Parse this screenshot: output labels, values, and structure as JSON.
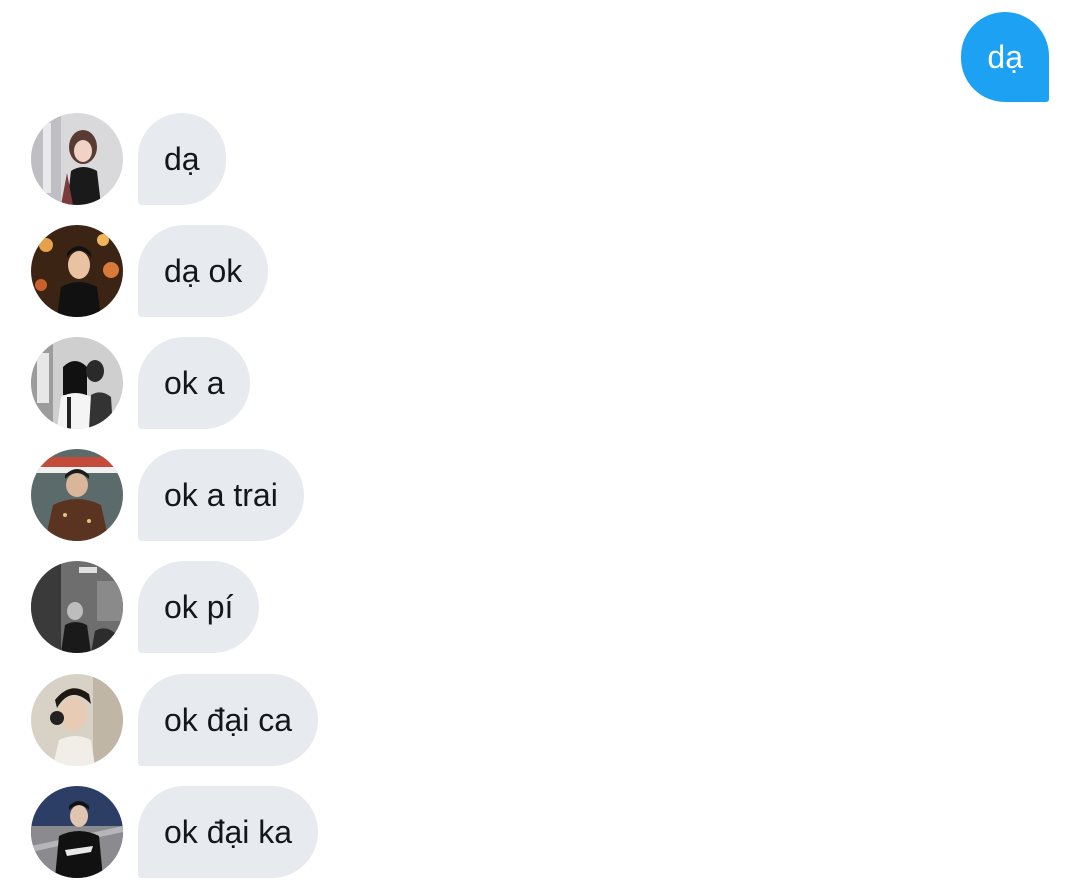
{
  "colors": {
    "outgoing_bubble": "#1da1f2",
    "incoming_bubble": "#e7ebef",
    "incoming_text": "#14171a",
    "outgoing_text": "#ffffff"
  },
  "outgoing": [
    {
      "text": "dạ"
    }
  ],
  "incoming": [
    {
      "avatar": "avatar-photo-1",
      "text": "dạ"
    },
    {
      "avatar": "avatar-photo-2",
      "text": "dạ ok"
    },
    {
      "avatar": "avatar-photo-3",
      "text": "ok a"
    },
    {
      "avatar": "avatar-photo-4",
      "text": "ok a trai"
    },
    {
      "avatar": "avatar-photo-5",
      "text": "ok pí"
    },
    {
      "avatar": "avatar-photo-6",
      "text": "ok đại ca"
    },
    {
      "avatar": "avatar-photo-7",
      "text": "ok đại ka"
    }
  ]
}
